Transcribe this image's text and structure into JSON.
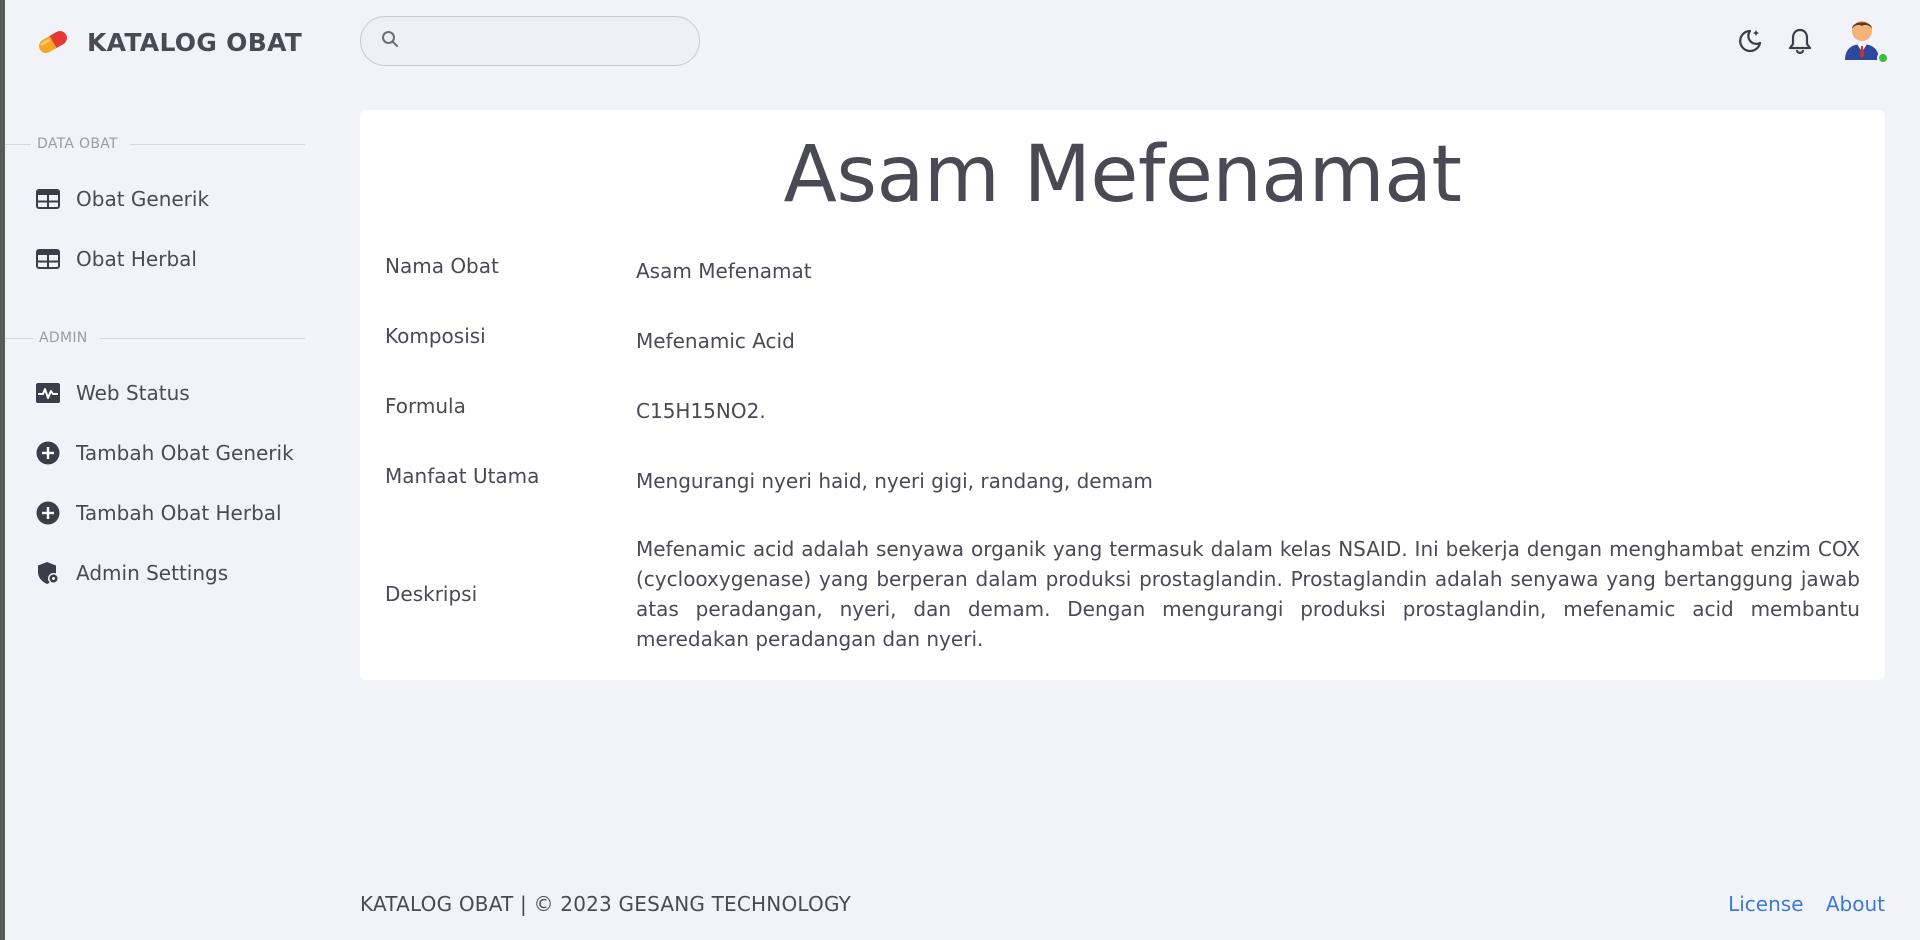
{
  "brand": {
    "title": "KATALOG OBAT",
    "logo_icon": "pill-icon"
  },
  "search": {
    "placeholder": "",
    "value": ""
  },
  "header_icons": [
    "moon-icon",
    "bell-icon",
    "avatar"
  ],
  "sidebar": {
    "sections": [
      {
        "label": "DATA OBAT",
        "items": [
          {
            "label": "Obat Generik",
            "icon": "table-icon"
          },
          {
            "label": "Obat Herbal",
            "icon": "table-icon"
          }
        ]
      },
      {
        "label": "ADMIN",
        "items": [
          {
            "label": "Web Status",
            "icon": "pulse-icon"
          },
          {
            "label": "Tambah Obat Generik",
            "icon": "plus-circle-icon"
          },
          {
            "label": "Tambah Obat Herbal",
            "icon": "plus-circle-icon"
          },
          {
            "label": "Admin Settings",
            "icon": "shield-gear-icon"
          }
        ]
      }
    ]
  },
  "detail": {
    "title": "Asam Mefenamat",
    "fields": [
      {
        "label": "Nama Obat",
        "value": "Asam Mefenamat"
      },
      {
        "label": "Komposisi",
        "value": "Mefenamic Acid"
      },
      {
        "label": "Formula",
        "value": "C15H15NO2."
      },
      {
        "label": "Manfaat Utama",
        "value": "Mengurangi nyeri haid, nyeri gigi, randang, demam"
      },
      {
        "label": "Deskripsi",
        "value": "Mefenamic acid adalah senyawa organik yang termasuk dalam kelas NSAID. Ini bekerja dengan menghambat enzim COX (cyclooxygenase) yang berperan dalam produksi prostaglandin. Prostaglandin adalah senyawa yang bertanggung jawab atas peradangan, nyeri, dan demam. Dengan mengurangi produksi prostaglandin, mefenamic acid membantu meredakan peradangan dan nyeri."
      }
    ]
  },
  "footer": {
    "text": "KATALOG OBAT | © 2023 GESANG TECHNOLOGY",
    "links": [
      "License",
      "About"
    ]
  },
  "colors": {
    "background": "#f2f3f8",
    "card": "#ffffff",
    "text": "#4a4a55",
    "link": "#3a7bd5",
    "online": "#3bbf3b"
  }
}
